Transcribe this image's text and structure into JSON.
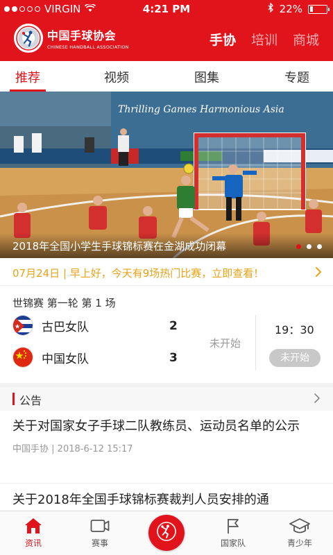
{
  "status_bar": {
    "carrier": "VIRGIN",
    "time": "4:21 PM",
    "battery": "22%",
    "battery_level": 0.22
  },
  "brand": {
    "name_cn": "中国手球协会",
    "name_en": "CHINESE HANDBALL ASSOCIATION"
  },
  "top_nav": [
    {
      "label": "手协",
      "active": true
    },
    {
      "label": "培训",
      "active": false
    },
    {
      "label": "商城",
      "active": false
    }
  ],
  "sub_tabs": [
    {
      "label": "推荐",
      "active": true
    },
    {
      "label": "视频",
      "active": false
    },
    {
      "label": "图集",
      "active": false
    },
    {
      "label": "专题",
      "active": false
    }
  ],
  "banner": {
    "caption": "2018年全国小学生手球锦标赛在金湖成功闭幕",
    "slide_count": 3,
    "active_slide": 1,
    "background_text": "Thrilling Games Harmonious Asia"
  },
  "notice": {
    "text": "07月24日 | 早上好，今天有9场热门比赛，立即查看！"
  },
  "match": {
    "title": "世锦赛 第一轮 第 1 场",
    "team1": {
      "name": "古巴女队",
      "score": "2",
      "flag": "cuba-flag-icon"
    },
    "team2": {
      "name": "中国女队",
      "score": "3",
      "flag": "china-flag-icon"
    },
    "status": "未开始",
    "time": "19：30",
    "button_label": "未开始"
  },
  "announcements": {
    "section_title": "公告",
    "items": [
      {
        "title": "关于对国家女子手球二队教练员、运动员名单的公示",
        "source": "中国手协",
        "date": "2018-6-12 15:17"
      },
      {
        "title": "关于2018年全国手球锦标赛裁判人员安排的通",
        "source": "",
        "date": ""
      }
    ]
  },
  "tab_bar": [
    {
      "label": "资讯",
      "icon": "home-icon",
      "active": true
    },
    {
      "label": "赛事",
      "icon": "video-icon",
      "active": false
    },
    {
      "label": "",
      "icon": "handball-player-icon",
      "active": false
    },
    {
      "label": "国家队",
      "icon": "flag-icon",
      "active": false
    },
    {
      "label": "青少年",
      "icon": "graduation-cap-icon",
      "active": false
    }
  ],
  "colors": {
    "brand_red": "#e1141c",
    "notice_orange": "#e8a317",
    "muted_gray": "#999999"
  }
}
